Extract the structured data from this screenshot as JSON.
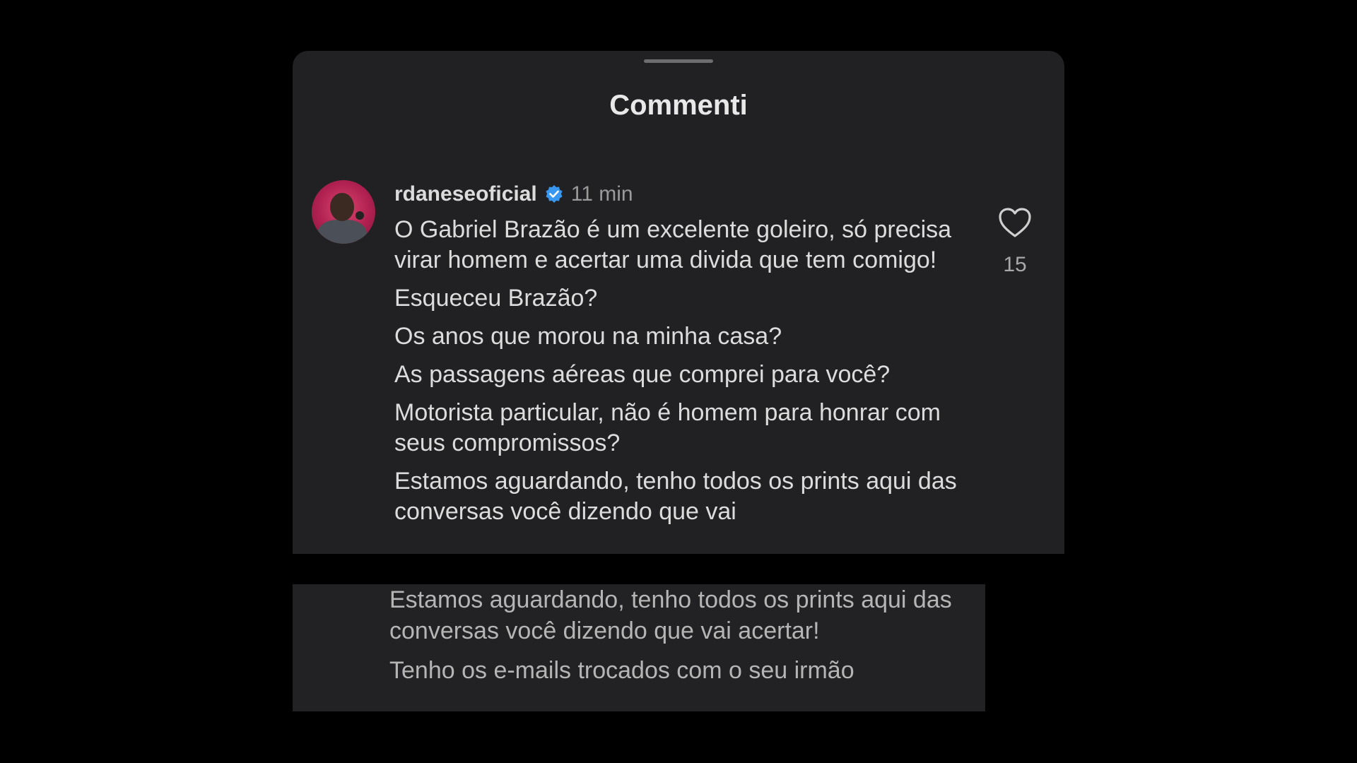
{
  "sheet": {
    "title": "Commenti"
  },
  "comment": {
    "username": "rdaneseoficial",
    "verified_icon": "verified-badge-icon",
    "time": "11 min",
    "paragraphs": [
      "O Gabriel Brazão é um excelente goleiro, só precisa virar homem e acertar uma divida que tem comigo!",
      "Esqueceu Brazão?",
      "Os anos que morou na minha casa?",
      "As passagens aéreas que comprei para você?",
      "Motorista particular, não é homem para honrar com seus compromissos?",
      "Estamos aguardando, tenho todos os prints aqui das conversas você dizendo que vai"
    ],
    "like_icon": "heart-icon",
    "like_count": "15"
  },
  "continuation": {
    "paragraphs": [
      "Estamos aguardando, tenho todos os prints aqui das conversas você dizendo que vai acertar!",
      "Tenho os e-mails trocados com o seu irmão"
    ]
  },
  "colors": {
    "background": "#000000",
    "panel": "#212124",
    "text": "#dcdcdc",
    "muted": "#9a9a9a",
    "verified": "#3897f0"
  }
}
